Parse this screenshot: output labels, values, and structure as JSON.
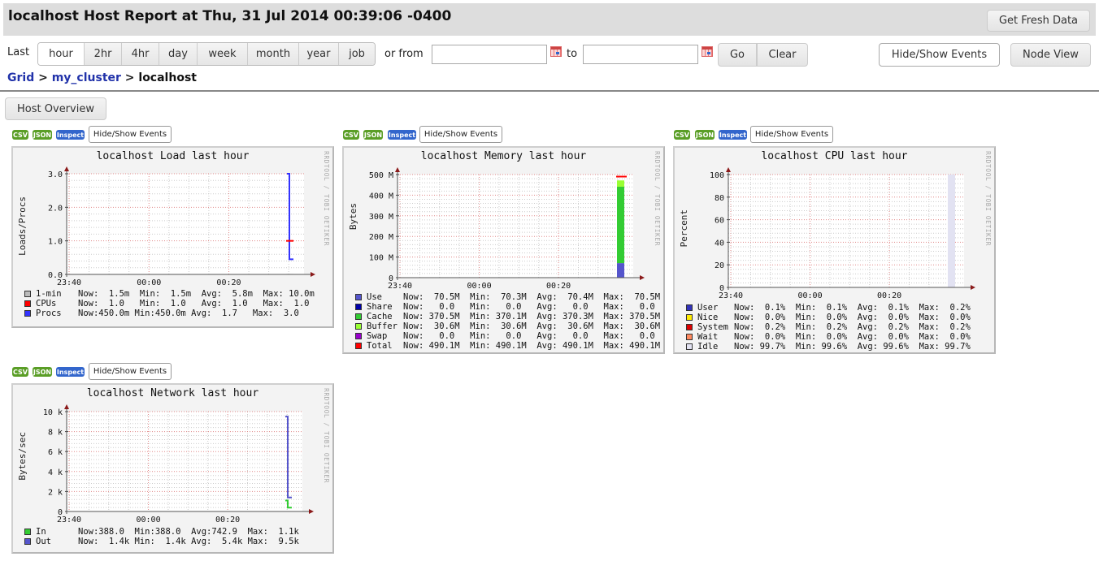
{
  "header": {
    "title": "localhost Host Report at Thu, 31 Jul 2014 00:39:06 -0400",
    "fresh_button": "Get Fresh Data"
  },
  "range": {
    "last_label": "Last",
    "options": [
      "hour",
      "2hr",
      "4hr",
      "day",
      "week",
      "month",
      "year",
      "job"
    ],
    "selected": "hour",
    "from_label": "or from",
    "to_label": "to",
    "from_value": "",
    "to_value": "",
    "go_button": "Go",
    "clear_button": "Clear",
    "events_button": "Hide/Show Events",
    "node_view_button": "Node View"
  },
  "breadcrumb": {
    "items": [
      "Grid",
      "my_cluster",
      "localhost"
    ],
    "separator": ">"
  },
  "host_overview_button": "Host Overview",
  "graph_toolbar": {
    "csv": "CSV",
    "json": "JSON",
    "inspect": "Inspect",
    "events": "Hide/Show Events"
  },
  "watermark": "RRDTOOL / TOBI OETIKER",
  "chart_data": [
    {
      "type": "line",
      "title": "localhost Load last hour",
      "ylabel": "Loads/Procs",
      "xlabel": "",
      "x_ticks": [
        "23:40",
        "00:00",
        "00:20"
      ],
      "y_ticks": [
        "0.0",
        "1.0",
        "2.0",
        "3.0"
      ],
      "ylim": [
        0,
        3
      ],
      "grid": true,
      "series": [
        {
          "name": "1-min",
          "color": "#bbbbbb",
          "stats": {
            "now": "1.5m",
            "min": "1.5m",
            "avg": "5.8m",
            "max": "10.0m"
          },
          "values": [
            0.0015
          ]
        },
        {
          "name": "CPUs",
          "color": "#ff0000",
          "stats": {
            "now": "1.0",
            "min": "1.0",
            "avg": "1.0",
            "max": "1.0"
          },
          "values": [
            1.0
          ]
        },
        {
          "name": "Procs",
          "color": "#3333ff",
          "stats": {
            "now": "450.0m",
            "min": "450.0m",
            "avg": "1.7",
            "max": "3.0"
          },
          "values": [
            3.0,
            0.45
          ]
        }
      ],
      "legend_rows": [
        {
          "name": "1-min",
          "color": "#bbbbbb",
          "text": "Now:  1.5m  Min:  1.5m  Avg:  5.8m  Max: 10.0m"
        },
        {
          "name": "CPUs",
          "color": "#ff0000",
          "text": "Now:  1.0   Min:  1.0   Avg:  1.0   Max:  1.0"
        },
        {
          "name": "Procs",
          "color": "#3333ff",
          "text": "Now:450.0m Min:450.0m Avg:  1.7   Max:  3.0"
        }
      ]
    },
    {
      "type": "area",
      "title": "localhost Memory last hour",
      "ylabel": "Bytes",
      "xlabel": "",
      "x_ticks": [
        "23:40",
        "00:00",
        "00:20"
      ],
      "y_ticks": [
        "0",
        "100 M",
        "200 M",
        "300 M",
        "400 M",
        "500 M"
      ],
      "ylim": [
        0,
        500
      ],
      "units": "MB",
      "grid": true,
      "stacked": true,
      "series": [
        {
          "name": "Use",
          "color": "#5555cc",
          "values": [
            70.5
          ]
        },
        {
          "name": "Share",
          "color": "#0000aa",
          "values": [
            0.0
          ]
        },
        {
          "name": "Cache",
          "color": "#33cc33",
          "values": [
            370.5
          ]
        },
        {
          "name": "Buffer",
          "color": "#99ff33",
          "values": [
            30.6
          ]
        },
        {
          "name": "Swap",
          "color": "#9900cc",
          "values": [
            0.0
          ]
        },
        {
          "name": "Total",
          "color": "#ff0000",
          "values": [
            490.1
          ],
          "line": true
        }
      ],
      "legend_rows": [
        {
          "name": "Use",
          "color": "#5555cc",
          "text": "Now:  70.5M  Min:  70.3M  Avg:  70.4M  Max:  70.5M"
        },
        {
          "name": "Share",
          "color": "#0000aa",
          "text": "Now:   0.0   Min:   0.0   Avg:   0.0   Max:   0.0"
        },
        {
          "name": "Cache",
          "color": "#33cc33",
          "text": "Now: 370.5M  Min: 370.1M  Avg: 370.3M  Max: 370.5M"
        },
        {
          "name": "Buffer",
          "color": "#99ff33",
          "text": "Now:  30.6M  Min:  30.6M  Avg:  30.6M  Max:  30.6M"
        },
        {
          "name": "Swap",
          "color": "#9900cc",
          "text": "Now:   0.0   Min:   0.0   Avg:   0.0   Max:   0.0"
        },
        {
          "name": "Total",
          "color": "#ff0000",
          "text": "Now: 490.1M  Min: 490.1M  Avg: 490.1M  Max: 490.1M"
        }
      ]
    },
    {
      "type": "area",
      "title": "localhost CPU last hour",
      "ylabel": "Percent",
      "xlabel": "",
      "x_ticks": [
        "23:40",
        "00:00",
        "00:20"
      ],
      "y_ticks": [
        "0",
        "20",
        "40",
        "60",
        "80",
        "100"
      ],
      "ylim": [
        0,
        100
      ],
      "grid": true,
      "stacked": true,
      "series": [
        {
          "name": "User",
          "color": "#3333bb",
          "values": [
            0.1
          ]
        },
        {
          "name": "Nice",
          "color": "#ffea00",
          "values": [
            0.0
          ]
        },
        {
          "name": "System",
          "color": "#dd0000",
          "values": [
            0.2
          ]
        },
        {
          "name": "Wait",
          "color": "#ff8a60",
          "values": [
            0.0
          ]
        },
        {
          "name": "Idle",
          "color": "#e2e2f2",
          "values": [
            99.7
          ]
        }
      ],
      "legend_rows": [
        {
          "name": "User",
          "color": "#3333bb",
          "text": "Now:  0.1%  Min:  0.1%  Avg:  0.1%  Max:  0.2%"
        },
        {
          "name": "Nice",
          "color": "#ffea00",
          "text": "Now:  0.0%  Min:  0.0%  Avg:  0.0%  Max:  0.0%"
        },
        {
          "name": "System",
          "color": "#dd0000",
          "text": "Now:  0.2%  Min:  0.2%  Avg:  0.2%  Max:  0.2%"
        },
        {
          "name": "Wait",
          "color": "#ff8a60",
          "text": "Now:  0.0%  Min:  0.0%  Avg:  0.0%  Max:  0.0%"
        },
        {
          "name": "Idle",
          "color": "#e2e2f2",
          "text": "Now: 99.7%  Min: 99.6%  Avg: 99.6%  Max: 99.7%"
        }
      ]
    },
    {
      "type": "line",
      "title": "localhost Network last hour",
      "ylabel": "Bytes/sec",
      "xlabel": "",
      "x_ticks": [
        "23:40",
        "00:00",
        "00:20"
      ],
      "y_ticks": [
        "0",
        "2 k",
        "4 k",
        "6 k",
        "8 k",
        "10 k"
      ],
      "ylim": [
        0,
        10000
      ],
      "grid": true,
      "series": [
        {
          "name": "In",
          "color": "#33cc33",
          "values": [
            1100,
            388
          ]
        },
        {
          "name": "Out",
          "color": "#5555cc",
          "values": [
            9500,
            1400
          ]
        }
      ],
      "legend_rows": [
        {
          "name": "In",
          "color": "#33cc33",
          "text": "Now:388.0  Min:388.0  Avg:742.9  Max:  1.1k"
        },
        {
          "name": "Out",
          "color": "#5555cc",
          "text": "Now:  1.4k Min:  1.4k Avg:  5.4k Max:  9.5k"
        }
      ]
    }
  ]
}
